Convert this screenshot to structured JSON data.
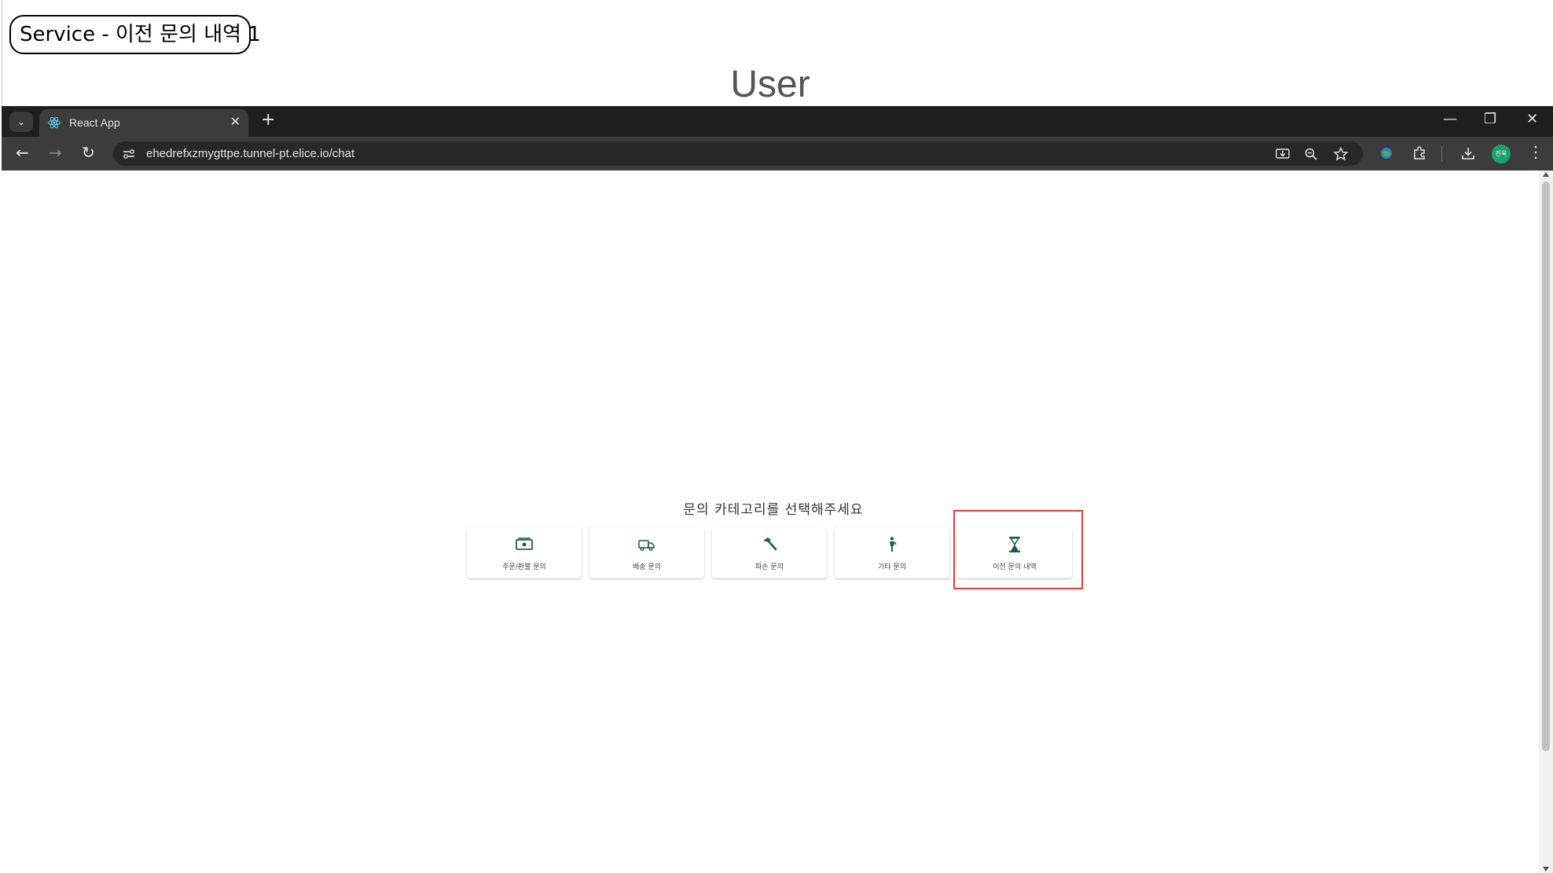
{
  "slide": {
    "label": "Service - 이전 문의 내역 1",
    "heading": "User"
  },
  "browser": {
    "tab_title": "React App",
    "url": "ehedrefxzmygttpe.tunnel-pt.elice.io/chat",
    "profile_initials": "진욱"
  },
  "page": {
    "category_prompt": "문의 카테고리를 선택해주세요",
    "categories": [
      {
        "label": "주문/환불 문의",
        "icon": "money-icon"
      },
      {
        "label": "배송 문의",
        "icon": "truck-icon"
      },
      {
        "label": "파손 문의",
        "icon": "hammer-icon"
      },
      {
        "label": "기타 문의",
        "icon": "person-icon"
      },
      {
        "label": "이전 문의 내역",
        "icon": "hourglass-icon"
      }
    ]
  },
  "colors": {
    "icon": "#1f5d52",
    "highlight": "#e53935",
    "chrome_dark": "#1f1f1f"
  }
}
